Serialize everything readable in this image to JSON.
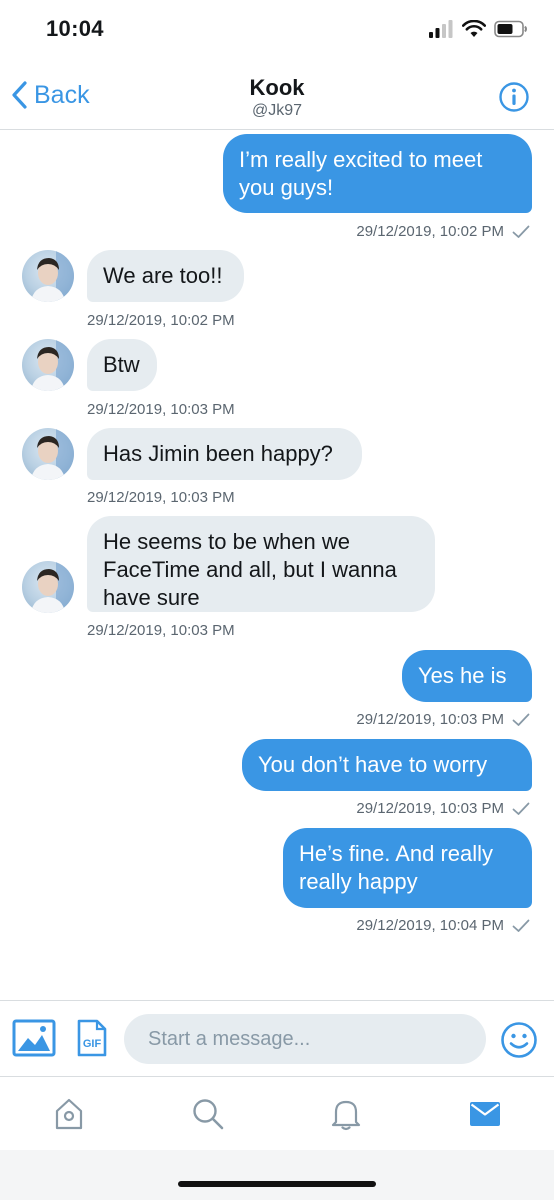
{
  "status_bar": {
    "time": "10:04"
  },
  "header": {
    "back_label": "Back",
    "name": "Kook",
    "handle": "@Jk97"
  },
  "messages": [
    {
      "direction": "out",
      "lines": [
        "I’m really excited to meet",
        "you guys!"
      ],
      "timestamp": "29/12/2019, 10:02 PM",
      "read": true
    },
    {
      "direction": "in",
      "lines": [
        "We are too!!"
      ],
      "timestamp": "29/12/2019, 10:02 PM"
    },
    {
      "direction": "in",
      "lines": [
        "Btw"
      ],
      "timestamp": "29/12/2019, 10:03 PM"
    },
    {
      "direction": "in",
      "lines": [
        "Has Jimin been happy?"
      ],
      "timestamp": "29/12/2019, 10:03 PM"
    },
    {
      "direction": "in",
      "lines": [
        "He seems to be when we",
        "FaceTime and all, but I wanna",
        "have sure"
      ],
      "timestamp": "29/12/2019, 10:03 PM"
    },
    {
      "direction": "out",
      "lines": [
        "Yes he is"
      ],
      "timestamp": "29/12/2019, 10:03 PM",
      "read": true
    },
    {
      "direction": "out",
      "lines": [
        "You don’t have to worry"
      ],
      "timestamp": "29/12/2019, 10:03 PM",
      "read": true
    },
    {
      "direction": "out",
      "lines": [
        "He’s fine. And really",
        "really happy"
      ],
      "timestamp": "29/12/2019, 10:04 PM",
      "read": true
    }
  ],
  "composer": {
    "placeholder": "Start a message...",
    "gif_label": "GIF"
  },
  "tabs": [
    {
      "icon": "home-icon"
    },
    {
      "icon": "search-icon"
    },
    {
      "icon": "bell-icon"
    },
    {
      "icon": "mail-icon",
      "active": true
    }
  ],
  "colors": {
    "accent": "#3a96e4",
    "incoming_bubble": "#e6ecf0",
    "muted_text": "#5b6670",
    "icon_gray": "#8899a6"
  }
}
